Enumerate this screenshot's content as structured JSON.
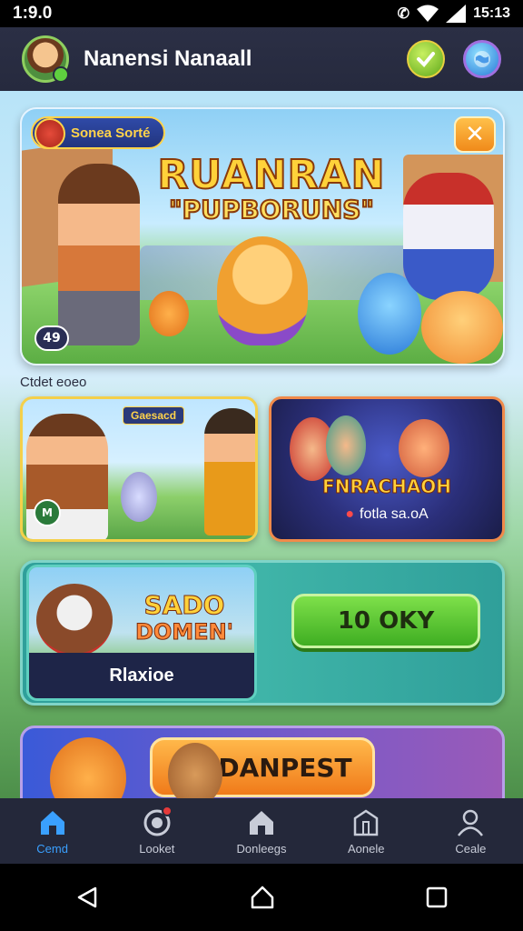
{
  "status_bar": {
    "time": "1:9.0",
    "clock": "15:13"
  },
  "header": {
    "title": "Nanensi Nanaall"
  },
  "hero": {
    "badge": "Sonea Sorté",
    "title_line1": "RUANRAN",
    "title_line2": "\"PUPBORUNS\"",
    "counter": "49"
  },
  "section": {
    "label": "Ctdet eoeo"
  },
  "cards": [
    {
      "tag": "Gaesacd",
      "badge": "M"
    },
    {
      "title": "FNRACHAOH",
      "subtitle": "fotla sa.oA"
    }
  ],
  "promo": {
    "title_line1": "SADO",
    "title_line2": "DOMEN'",
    "footer": "Rlaxioe",
    "button_label": "10 OKY"
  },
  "bottom_banner": {
    "button_label": "DANPEST"
  },
  "bottom_nav": [
    {
      "label": "Cemd",
      "icon": "home-icon",
      "active": true
    },
    {
      "label": "Looket",
      "icon": "target-icon",
      "active": false
    },
    {
      "label": "Donleegs",
      "icon": "house-icon",
      "active": false
    },
    {
      "label": "Aonele",
      "icon": "building-icon",
      "active": false
    },
    {
      "label": "Ceale",
      "icon": "profile-icon",
      "active": false
    }
  ],
  "colors": {
    "accent": "#3aa0ff",
    "title_gold": "#ffd23a",
    "promo_green": "#3fae22",
    "nav_bg": "#24283a"
  }
}
